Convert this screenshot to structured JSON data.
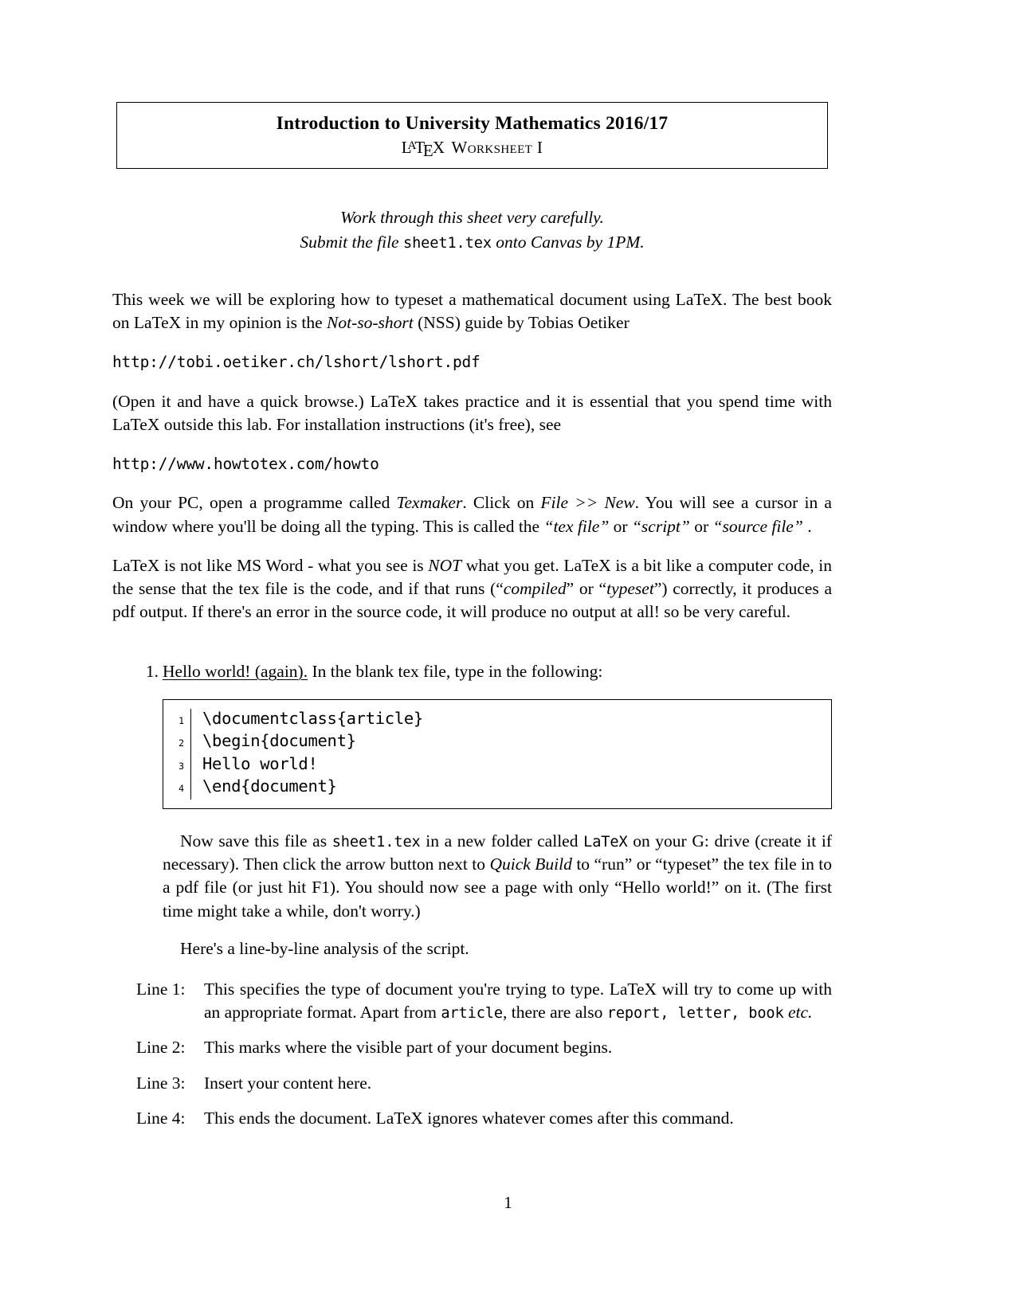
{
  "document": {
    "page_number": "1"
  },
  "title_box": {
    "line1": "Introduction to University Mathematics 2016/17",
    "latex_logo": {
      "l": "L",
      "a": "A",
      "t": "T",
      "e": "E",
      "x": "X"
    },
    "line2_suffix": "Worksheet I"
  },
  "intro": {
    "line1": "Work through this sheet very carefully.",
    "line2_before": "Submit the file ",
    "line2_mono": "sheet1.tex",
    "line2_after": " onto Canvas by 1PM."
  },
  "paragraphs": {
    "p1_a": "This week we will be exploring how to typeset a mathematical document using LaTeX. The best book on LaTeX in my opinion is the ",
    "p1_italic": "Not-so-short",
    "p1_b": " (NSS) guide by Tobias Oetiker",
    "url1": "http://tobi.oetiker.ch/lshort/lshort.pdf",
    "p2": "(Open it and have a quick browse.) LaTeX takes practice and it is essential that you spend time with LaTeX outside this lab. For installation instructions (it's free), see",
    "url2": "http://www.howtotex.com/howto",
    "p3_a": "On your PC, open a programme called ",
    "p3_it1": "Texmaker",
    "p3_b": ". Click on ",
    "p3_it2": "File >> New",
    "p3_c": ". You will see a cursor in a window where you'll be doing all the typing. This is called the ",
    "p3_it3": "“tex file”",
    "p3_d": " or ",
    "p3_it4": "“script”",
    "p3_e": " or ",
    "p3_it5": "“source file”",
    "p3_f": " .",
    "p4_a": "LaTeX is not like MS Word - what you see is ",
    "p4_it1": "NOT",
    "p4_b": " what you get. LaTeX is a bit like a computer code, in the sense that the tex file is the code, and if that runs (“",
    "p4_it2": "compiled",
    "p4_c": "” or “",
    "p4_it3": "typeset",
    "p4_d": "”) correctly, it produces a pdf output. If there's an error in the source code, it will produce no output at all! so be very careful."
  },
  "enumerate": {
    "item1": {
      "number": "1.",
      "underlined": "Hello world! (again).",
      "rest": " In the blank tex file, type in the following:"
    }
  },
  "code_listing": {
    "lines": [
      {
        "no": "1",
        "text": "\\documentclass{article}"
      },
      {
        "no": "2",
        "text": "\\begin{document}"
      },
      {
        "no": "3",
        "text": "Hello world!"
      },
      {
        "no": "4",
        "text": "\\end{document}"
      }
    ]
  },
  "after_code": {
    "s1_a": "Now save this file as ",
    "s1_mono1": "sheet1.tex",
    "s1_b": " in a new folder called ",
    "s1_mono2": "LaTeX",
    "s1_c": " on your G: drive (create it if necessary). Then click the arrow button next to ",
    "s1_it": "Quick Build",
    "s1_d": " to “run” or “typeset” the tex file in to a pdf file (or just hit F1). You should now see a page with only “Hello world!” on it. (The first time might take a while, don't worry.)",
    "s2": "Here's a line-by-line analysis of the script."
  },
  "line_descriptions": [
    {
      "term": "Line 1:",
      "a": "This specifies the type of document you're trying to type. LaTeX will try to come up with an appropriate format. Apart from ",
      "mono1": "article",
      "b": ", there are also ",
      "mono2": "report, letter, book",
      "c": " ",
      "it": "etc.",
      "d": ""
    },
    {
      "term": "Line 2:",
      "a": "This marks where the visible part of your document begins.",
      "mono1": "",
      "b": "",
      "mono2": "",
      "c": "",
      "it": "",
      "d": ""
    },
    {
      "term": "Line 3:",
      "a": "Insert your content here.",
      "mono1": "",
      "b": "",
      "mono2": "",
      "c": "",
      "it": "",
      "d": ""
    },
    {
      "term": "Line 4:",
      "a": "This ends the document. LaTeX ignores whatever comes after this command.",
      "mono1": "",
      "b": "",
      "mono2": "",
      "c": "",
      "it": "",
      "d": ""
    }
  ]
}
